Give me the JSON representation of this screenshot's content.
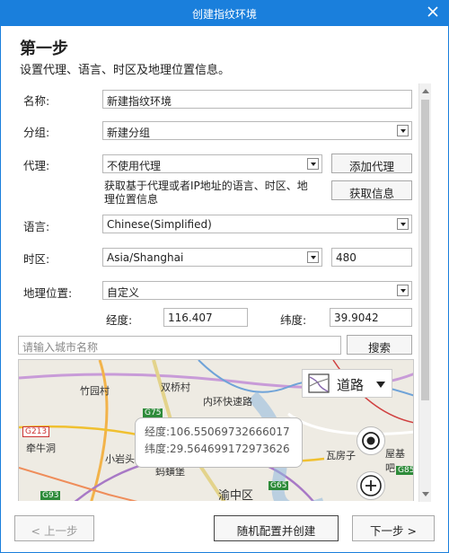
{
  "window": {
    "title": "创建指纹环境"
  },
  "header": {
    "step_title": "第一步",
    "step_desc": "设置代理、语言、时区及地理位置信息。"
  },
  "form": {
    "name_label": "名称:",
    "name_value": "新建指纹环境",
    "group_label": "分组:",
    "group_value": "新建分组",
    "proxy_label": "代理:",
    "proxy_value": "不使用代理",
    "add_proxy_button": "添加代理",
    "proxy_hint_line1": "获取基于代理或者IP地址的语言、时区、地",
    "proxy_hint_line2": "理位置信息",
    "fetch_info_button": "获取信息",
    "language_label": "语言:",
    "language_value": "Chinese(Simplified)",
    "timezone_label": "时区:",
    "timezone_value": "Asia/Shanghai",
    "timezone_offset": "480",
    "geo_label": "地理位置:",
    "geo_value": "自定义",
    "longitude_label": "经度:",
    "longitude_value": "116.407",
    "latitude_label": "纬度:",
    "latitude_value": "39.9042",
    "city_search_placeholder": "请输入城市名称",
    "search_button": "搜索"
  },
  "map": {
    "type_label": "道路",
    "tooltip_longitude": "经度:106.55069732666017",
    "tooltip_latitude": "纬度:29.564699172973626",
    "places": [
      "竹园村",
      "双桥村",
      "内环快速路",
      "牵牛洞",
      "小岩头",
      "蚂蟥堡",
      "渝中区",
      "瓦房子",
      "屋基吧"
    ],
    "road_badges": [
      "G65",
      "G75",
      "G93",
      "G85",
      "G213"
    ]
  },
  "footer": {
    "prev_button": "< 上一步",
    "random_create_button": "随机配置并创建",
    "next_button": "下一步 >"
  },
  "colors": {
    "titlebar": "#1a7fdc"
  }
}
